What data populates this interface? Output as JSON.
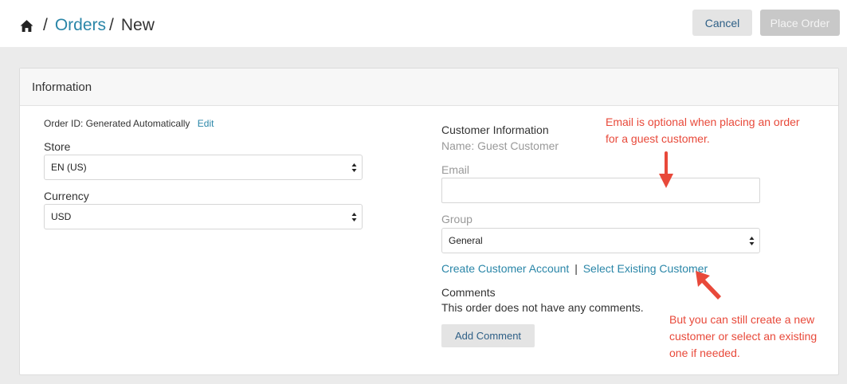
{
  "breadcrumb": {
    "home_icon": "home-icon",
    "separator": "/",
    "orders": "Orders",
    "current": "New"
  },
  "header_actions": {
    "cancel": "Cancel",
    "place_order": "Place Order"
  },
  "panel": {
    "title": "Information"
  },
  "order": {
    "id_text": "Order ID: Generated Automatically",
    "edit": "Edit",
    "store_label": "Store",
    "store_value": "EN (US)",
    "currency_label": "Currency",
    "currency_value": "USD"
  },
  "customer": {
    "heading": "Customer Information",
    "name": "Name: Guest Customer",
    "email_label": "Email",
    "email_value": "",
    "group_label": "Group",
    "group_value": "General",
    "create_link": "Create Customer Account",
    "divider": "|",
    "select_link": "Select Existing Customer"
  },
  "comments": {
    "heading": "Comments",
    "empty_text": "This order does not have any comments.",
    "add_button": "Add Comment"
  },
  "annotations": {
    "note_top_line1": "Email is optional when placing an order",
    "note_top_line2": "for a guest customer.",
    "note_bottom_line1": "But you can still create a new",
    "note_bottom_line2": "customer or select an existing",
    "note_bottom_line3": "one if needed.",
    "color": "#e8493a"
  },
  "colors": {
    "link": "#2a86a8",
    "button_text": "#2e5f86",
    "background": "#ebebeb"
  }
}
